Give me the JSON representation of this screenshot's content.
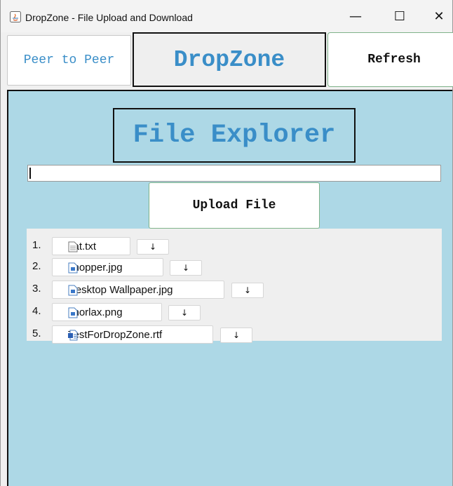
{
  "window": {
    "title": "DropZone - File Upload and Download",
    "minimize_glyph": "—",
    "maximize_glyph": "☐",
    "close_glyph": "✕"
  },
  "toolbar": {
    "peer_label": "Peer to Peer",
    "brand_label": "DropZone",
    "refresh_label": "Refresh"
  },
  "explorer": {
    "title": "File Explorer",
    "path_value": "",
    "upload_label": "Upload File"
  },
  "files": [
    {
      "index": "1.",
      "name": "cat.txt",
      "icon": "text-file-icon",
      "download_glyph": "↓"
    },
    {
      "index": "2.",
      "name": "chopper.jpg",
      "icon": "image-file-icon",
      "download_glyph": "↓"
    },
    {
      "index": "3.",
      "name": "Desktop Wallpaper.jpg",
      "icon": "image-file-icon",
      "download_glyph": "↓"
    },
    {
      "index": "4.",
      "name": "snorlax.png",
      "icon": "image-file-icon",
      "download_glyph": "↓"
    },
    {
      "index": "5.",
      "name": "TestForDropZone.rtf",
      "icon": "document-file-icon",
      "download_glyph": "↓"
    }
  ],
  "colors": {
    "accent": "#3a8ec8",
    "panel_bg": "#add8e6"
  }
}
